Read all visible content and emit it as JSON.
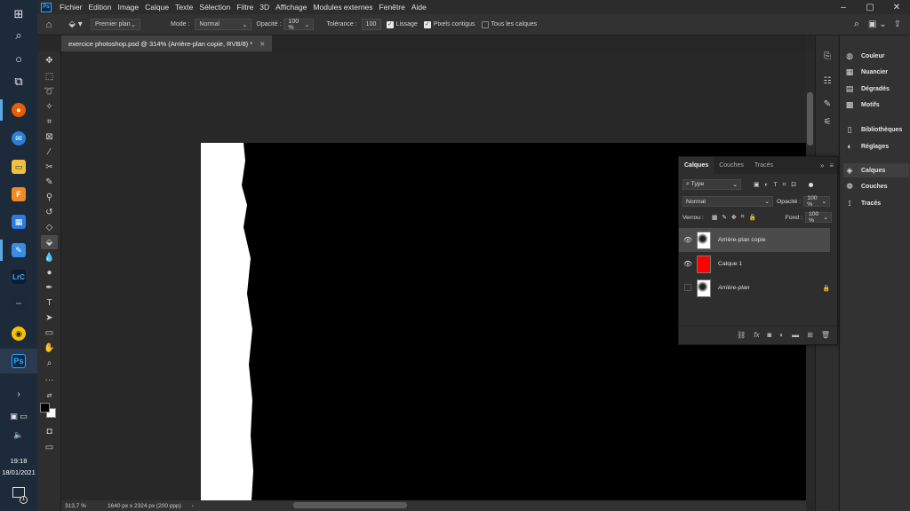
{
  "taskbar": {
    "time": "19:18",
    "date": "18/01/2021",
    "notification_count": "1"
  },
  "menu": {
    "app_icon": "Ps",
    "items": [
      "Fichier",
      "Edition",
      "Image",
      "Calque",
      "Texte",
      "Sélection",
      "Filtre",
      "3D",
      "Affichage",
      "Modules externes",
      "Fenêtre",
      "Aide"
    ]
  },
  "options": {
    "fill_source": "Premier plan",
    "mode_label": "Mode :",
    "mode_value": "Normal",
    "opacity_label": "Opacité :",
    "opacity_value": "100 %",
    "tolerance_label": "Tolérance :",
    "tolerance_value": "100",
    "antialias_label": "Lissage",
    "contiguous_label": "Pixels contigus",
    "all_layers_label": "Tous les calques"
  },
  "document": {
    "tab_title": "exercice photoshop.psd @ 314% (Arrière-plan copie, RVB/8) *",
    "zoom": "313,7 %",
    "info": "1640 px x 2324 px (200 ppp)"
  },
  "right_panels": {
    "items": [
      "Couleur",
      "Nuancier",
      "Dégradés",
      "Motifs",
      "Bibliothèques",
      "Réglages",
      "Calques",
      "Couches",
      "Tracés"
    ]
  },
  "layers_panel": {
    "tabs": [
      "Calques",
      "Couches",
      "Tracés"
    ],
    "filter_label": "Type",
    "blend_mode": "Normal",
    "opacity_label": "Opacité :",
    "opacity_value": "100 %",
    "lock_label": "Verrou :",
    "fill_label": "Fond :",
    "fill_value": "100 %",
    "layers": [
      {
        "name": "Arrière-plan copie",
        "visible": true,
        "selected": true
      },
      {
        "name": "Calque 1",
        "visible": true,
        "color": "#ff0000"
      },
      {
        "name": "Arrière-plan",
        "visible": false,
        "locked": true
      }
    ]
  }
}
